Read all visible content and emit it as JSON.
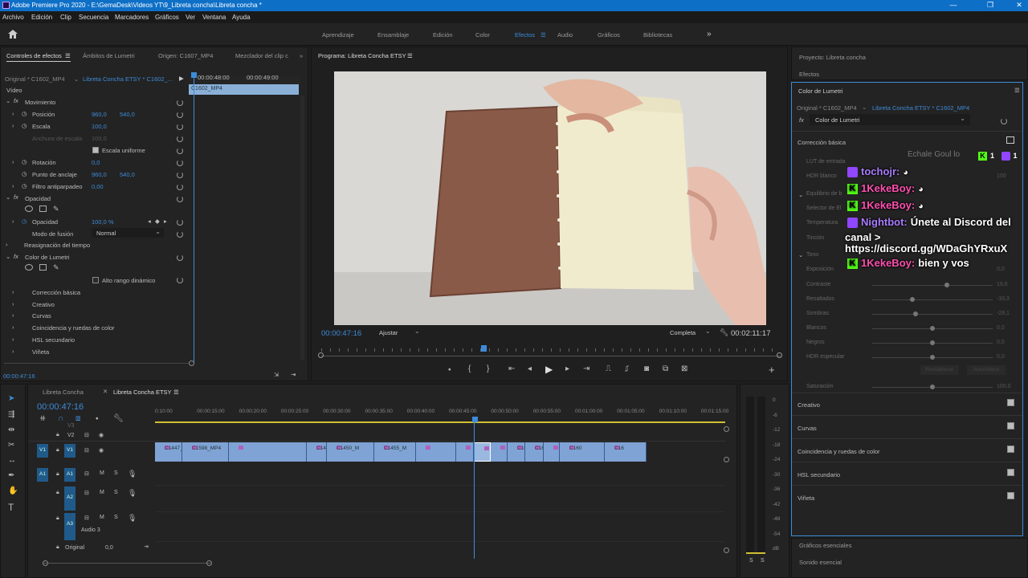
{
  "title": "Adobe Premiere Pro 2020 - E:\\GemaDesk\\Videos YT\\9_Libreta concha\\Libreta concha *",
  "window_controls": {
    "min": "—",
    "max": "❐",
    "close": "✕"
  },
  "menu": [
    "Archivo",
    "Edición",
    "Clip",
    "Secuencia",
    "Marcadores",
    "Gráficos",
    "Ver",
    "Ventana",
    "Ayuda"
  ],
  "workspaces": [
    "Aprendizaje",
    "Ensamblaje",
    "Edición",
    "Color",
    "Efectos",
    "Audio",
    "Gráficos",
    "Bibliotecas"
  ],
  "workspaces_more": "»",
  "active_workspace": "Efectos",
  "effect_controls": {
    "tabs": [
      "Controles de efectos",
      "Ámbitos de Lumetri",
      "Origen: C1607_MP4",
      "Mezclador del clip c"
    ],
    "source": "Original * C1602_MP4",
    "sequence": "Libreta Concha ETSY * C1602_...",
    "tc1": "00:00:48:00",
    "tc2": "00:00:49:00",
    "clip_label": "C1602_MP4",
    "video_label": "Vídeo",
    "motion": "Movimiento",
    "position": "Posición",
    "pos_x": "960,0",
    "pos_y": "540,0",
    "scale": "Escala",
    "scale_v": "100,0",
    "scale_w": "Anchura de escala",
    "scale_w_v": "100,0",
    "uniform": "Escala uniforme",
    "rotation": "Rotación",
    "rotation_v": "0,0",
    "anchor": "Punto de anclaje",
    "anchor_x": "960,0",
    "anchor_y": "540,0",
    "flicker": "Filtro antiparpadeo",
    "flicker_v": "0,00",
    "opacity_group": "Opacidad",
    "opacity": "Opacidad",
    "opacity_v": "100,0 %",
    "blend": "Modo de fusión",
    "blend_v": "Normal",
    "time_remap": "Reasignación del tiempo",
    "lumetri": "Color de Lumetri",
    "hdr": "Alto rango dinámico",
    "sections": [
      "Corrección básica",
      "Creativo",
      "Curvas",
      "Coincidencia y ruedas de color",
      "HSL secundario",
      "Viñeta"
    ],
    "timecode": "00:00:47:16"
  },
  "program": {
    "title": "Programa: Libreta Concha ETSY",
    "timecode": "00:00:47:16",
    "fit": "Ajustar",
    "quality": "Completa",
    "duration": "00:02:11:17"
  },
  "project_title": "Proyecto: Libreta concha",
  "effects_tab": "Efectos",
  "lumetri": {
    "title": "Color de Lumetri",
    "source": "Original * C1602_MP4",
    "seq": "Libreta Concha ETSY * C1602_MP4",
    "effect": "Color de Lumetri",
    "basic": "Corrección básica",
    "rows": [
      {
        "label": "LUT de entrada",
        "value": ""
      },
      {
        "label": "HDR blanco",
        "value": "100"
      },
      {
        "label": "Equilibrio de b",
        "value": ""
      },
      {
        "label": "Selector de El",
        "value": ""
      },
      {
        "label": "Temperatura",
        "value": ""
      },
      {
        "label": "Tinción",
        "value": ""
      },
      {
        "label": "Tono",
        "value": ""
      },
      {
        "label": "Exposición",
        "value": "0,0"
      },
      {
        "label": "Contraste",
        "value": "19,6",
        "pos": 0.62
      },
      {
        "label": "Resaltados",
        "value": "-33,3",
        "pos": 0.33
      },
      {
        "label": "Sombras",
        "value": "-28,1",
        "pos": 0.36
      },
      {
        "label": "Blancos",
        "value": "0,0",
        "pos": 0.5
      },
      {
        "label": "Negros",
        "value": "0,0",
        "pos": 0.5
      },
      {
        "label": "HDR especular",
        "value": "0,0",
        "pos": 0.5
      },
      {
        "label": "Saturación",
        "value": "100,0",
        "pos": 0.5
      }
    ],
    "reset_btn": "Restablecer",
    "auto_btn": "Automático",
    "sections": [
      "Creativo",
      "Curvas",
      "Coincidencia y ruedas de color",
      "HSL secundario",
      "Viñeta"
    ]
  },
  "bottom_right": [
    "Gráficos esenciales",
    "Sonido esencial"
  ],
  "chat": [
    {
      "platform": "twitch",
      "user": "tochojr:",
      "msg": "",
      "color": "#a97bff"
    },
    {
      "platform": "kick",
      "user": "1KekeBoy:",
      "msg": "",
      "color": "#ff4fb0"
    },
    {
      "platform": "kick",
      "user": "1KekeBoy:",
      "msg": "",
      "color": "#ff4fb0"
    },
    {
      "platform": "twitch",
      "user": "Nightbot:",
      "msg": "Únete al Discord del",
      "color": "#a97bff"
    },
    {
      "platform": "none",
      "user": "",
      "msg": "canal >",
      "color": "#fff"
    },
    {
      "platform": "none",
      "user": "",
      "msg": "https://discord.gg/WDaGhYRxuX",
      "color": "#fff"
    },
    {
      "platform": "kick",
      "user": "1KekeBoy:",
      "msg": "bien y vos",
      "color": "#ff4fb0"
    }
  ],
  "chat_partial": "Echale Goul lo",
  "viewer_counts": {
    "kick": "1",
    "twitch": "1"
  },
  "timeline": {
    "tabs": [
      "Libreta Concha",
      "Libreta Concha ETSY"
    ],
    "timecode": "00:00:47:16",
    "ruler": [
      "0:10:00",
      "00:00:15:00",
      "00:00:20:00",
      "00:00:25:00",
      "00:00:30:00",
      "00:00:35:00",
      "00:00:40:00",
      "00:00:45:00",
      "00:00:50:00",
      "00:00:55:00",
      "00:01:00:00",
      "00:01:05:00",
      "00:01:10:00",
      "00:01:15:00"
    ],
    "clips": [
      "C1447_MP4",
      "C1598_MP4",
      "",
      "C1435_MP4",
      "C1450_M",
      "C1455_M",
      "",
      "",
      "",
      "",
      "C1602_MP4",
      "C1603_M",
      "",
      "C160",
      "C16"
    ],
    "tracks": {
      "v3": "V3",
      "v2": "V2",
      "v1": "V1",
      "a1": "A1",
      "a2": "A2",
      "a3": "A3",
      "audio3": "Audio 3",
      "original": "Original",
      "orig_v": "0,0"
    },
    "meter": [
      "0",
      "-6",
      "-12",
      "-18",
      "-24",
      "-30",
      "-36",
      "-42",
      "-48",
      "-54",
      "dB"
    ],
    "solo": [
      "S",
      "S"
    ]
  }
}
